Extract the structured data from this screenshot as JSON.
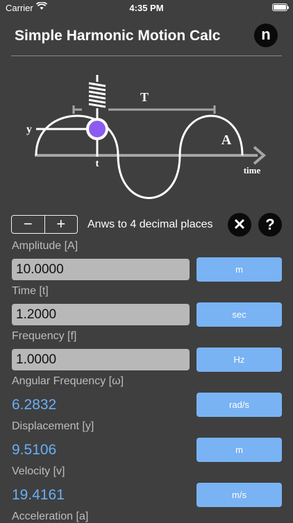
{
  "status": {
    "carrier": "Carrier",
    "time": "4:35 PM"
  },
  "header": {
    "title": "Simple Harmonic Motion Calc",
    "logo_letter": "n"
  },
  "diagram": {
    "period_label": "T",
    "displacement_label": "y",
    "time_marker_label": "t",
    "amplitude_label": "A",
    "axis_label": "time",
    "mass_color": "#8c5cf0"
  },
  "controls": {
    "minus": "−",
    "plus": "+",
    "decimals_label": "Anws to 4 decimal places",
    "clear_symbol": "✕",
    "help_symbol": "?"
  },
  "fields": {
    "amplitude": {
      "label": "Amplitude [A]",
      "value": "10.0000",
      "unit": "m"
    },
    "time": {
      "label": "Time [t]",
      "value": "1.2000",
      "unit": "sec"
    },
    "frequency": {
      "label": "Frequency [f]",
      "value": "1.0000",
      "unit": "Hz"
    },
    "angular_frequency": {
      "label": "Angular Frequency [ω]",
      "value": "6.2832",
      "unit": "rad/s"
    },
    "displacement": {
      "label": "Displacement [y]",
      "value": "9.5106",
      "unit": "m"
    },
    "velocity": {
      "label": "Velocity [v]",
      "value": "19.4161",
      "unit": "m/s"
    },
    "acceleration": {
      "label": "Acceleration [a]"
    }
  },
  "colors": {
    "background": "#3f3f3f",
    "accent": "#79b3f3",
    "result_text": "#6aaef7"
  }
}
